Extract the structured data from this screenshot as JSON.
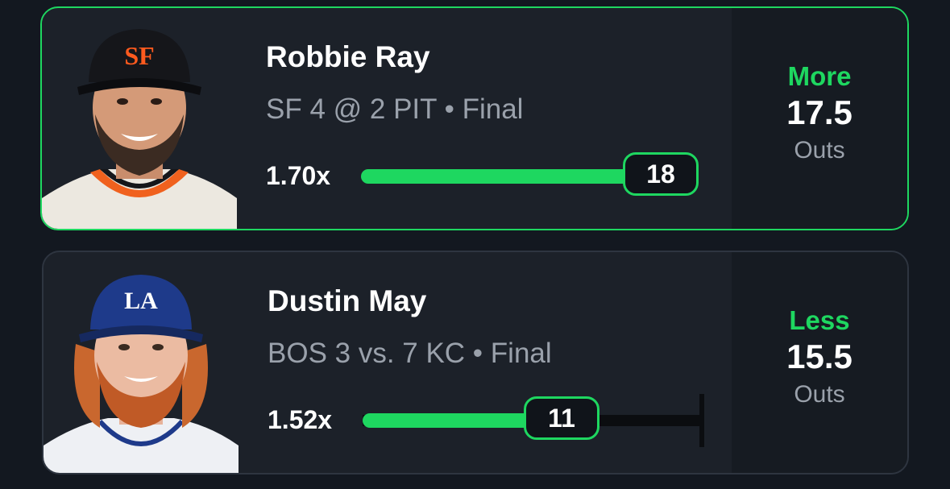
{
  "picks": [
    {
      "player": "Robbie Ray",
      "game": "SF 4 @ 2 PIT • Final",
      "multiplier": "1.70x",
      "result": "18",
      "direction": "More",
      "line": "17.5",
      "stat": "Outs",
      "progress_fraction": 1.0,
      "team_logo": "SF",
      "cap_color": "#15161a",
      "logo_color": "#fd5a1e"
    },
    {
      "player": "Dustin May",
      "game": "BOS 3 vs. 7 KC • Final",
      "multiplier": "1.52x",
      "result": "11",
      "direction": "Less",
      "line": "15.5",
      "stat": "Outs",
      "progress_fraction": 0.71,
      "team_logo": "LA",
      "cap_color": "#1e3a8a",
      "logo_color": "#ffffff"
    }
  ],
  "colors": {
    "accent": "#1ed760",
    "card_bg": "#1c2129",
    "page_bg": "#131820"
  },
  "icons": [
    "player-headshot",
    "team-cap-logo"
  ]
}
